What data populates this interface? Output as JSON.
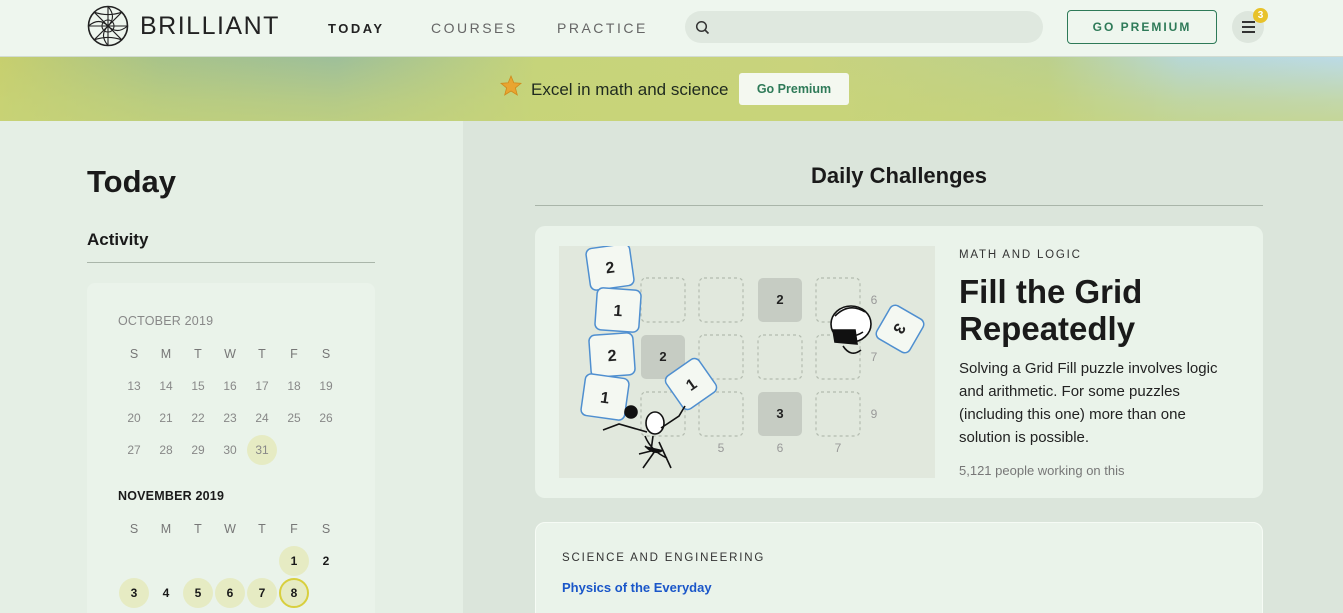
{
  "brand": {
    "name": "BRILLIANT",
    "logo_icon": "brilliant-logo-icon"
  },
  "nav": {
    "today": "TODAY",
    "courses": "COURSES",
    "practice": "PRACTICE"
  },
  "search": {
    "placeholder": "",
    "icon": "search-icon"
  },
  "header": {
    "go_premium": "GO PREMIUM",
    "notification_count": "3",
    "menu_icon": "hamburger-icon"
  },
  "banner": {
    "message": "Excel in math and science",
    "button": "Go Premium",
    "icon": "star-icon"
  },
  "sidebar": {
    "title": "Today",
    "activity_label": "Activity",
    "weekdays": [
      "S",
      "M",
      "T",
      "W",
      "T",
      "F",
      "S"
    ],
    "october": {
      "label": "OCTOBER 2019",
      "days": [
        "13",
        "14",
        "15",
        "16",
        "17",
        "18",
        "19",
        "20",
        "21",
        "22",
        "23",
        "24",
        "25",
        "26",
        "27",
        "28",
        "29",
        "30",
        "31"
      ],
      "active_days": [
        "31"
      ]
    },
    "november": {
      "label": "NOVEMBER 2019",
      "days": [
        "1",
        "2",
        "3",
        "4",
        "5",
        "6",
        "7",
        "8"
      ],
      "active_days": [
        "1",
        "3",
        "5",
        "6",
        "7",
        "8"
      ],
      "today": "8"
    }
  },
  "main": {
    "heading": "Daily Challenges",
    "challenge1": {
      "category": "MATH AND LOGIC",
      "title": "Fill the Grid Repeatedly",
      "description": "Solving a Grid Fill puzzle involves logic and arithmetic. For some puzzles (including this one) more than one solution is possible.",
      "participants": "5,121 people working on this",
      "illustration": {
        "tiles": [
          "2",
          "1",
          "2",
          "1",
          "1",
          "3"
        ],
        "grid_values": [
          "2",
          "2",
          "3"
        ],
        "side_numbers": [
          "6",
          "7",
          "9"
        ],
        "bottom_numbers": [
          "5",
          "6",
          "7"
        ]
      }
    },
    "challenge2": {
      "category": "SCIENCE AND ENGINEERING",
      "course_link": "Physics of the Everyday"
    }
  },
  "colors": {
    "accent": "#2e7a58",
    "badge": "#e8c22a",
    "link": "#1a56c9",
    "highlight_day": "#e6ebc3",
    "today_ring": "#d8cf3e"
  }
}
